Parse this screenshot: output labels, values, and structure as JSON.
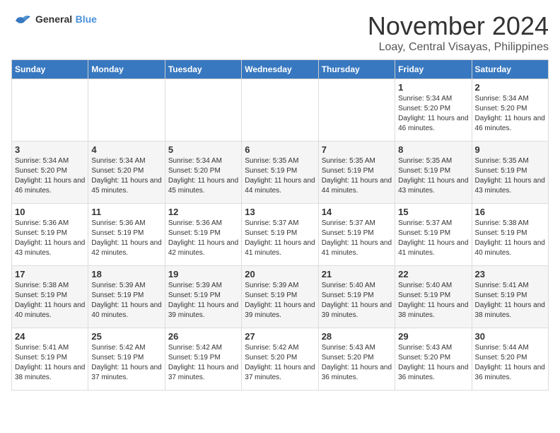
{
  "header": {
    "logo": {
      "general": "General",
      "blue": "Blue"
    },
    "month": "November 2024",
    "location": "Loay, Central Visayas, Philippines"
  },
  "weekdays": [
    "Sunday",
    "Monday",
    "Tuesday",
    "Wednesday",
    "Thursday",
    "Friday",
    "Saturday"
  ],
  "weeks": [
    [
      {
        "day": "",
        "info": ""
      },
      {
        "day": "",
        "info": ""
      },
      {
        "day": "",
        "info": ""
      },
      {
        "day": "",
        "info": ""
      },
      {
        "day": "",
        "info": ""
      },
      {
        "day": "1",
        "info": "Sunrise: 5:34 AM\nSunset: 5:20 PM\nDaylight: 11 hours and 46 minutes."
      },
      {
        "day": "2",
        "info": "Sunrise: 5:34 AM\nSunset: 5:20 PM\nDaylight: 11 hours and 46 minutes."
      }
    ],
    [
      {
        "day": "3",
        "info": "Sunrise: 5:34 AM\nSunset: 5:20 PM\nDaylight: 11 hours and 46 minutes."
      },
      {
        "day": "4",
        "info": "Sunrise: 5:34 AM\nSunset: 5:20 PM\nDaylight: 11 hours and 45 minutes."
      },
      {
        "day": "5",
        "info": "Sunrise: 5:34 AM\nSunset: 5:20 PM\nDaylight: 11 hours and 45 minutes."
      },
      {
        "day": "6",
        "info": "Sunrise: 5:35 AM\nSunset: 5:19 PM\nDaylight: 11 hours and 44 minutes."
      },
      {
        "day": "7",
        "info": "Sunrise: 5:35 AM\nSunset: 5:19 PM\nDaylight: 11 hours and 44 minutes."
      },
      {
        "day": "8",
        "info": "Sunrise: 5:35 AM\nSunset: 5:19 PM\nDaylight: 11 hours and 43 minutes."
      },
      {
        "day": "9",
        "info": "Sunrise: 5:35 AM\nSunset: 5:19 PM\nDaylight: 11 hours and 43 minutes."
      }
    ],
    [
      {
        "day": "10",
        "info": "Sunrise: 5:36 AM\nSunset: 5:19 PM\nDaylight: 11 hours and 43 minutes."
      },
      {
        "day": "11",
        "info": "Sunrise: 5:36 AM\nSunset: 5:19 PM\nDaylight: 11 hours and 42 minutes."
      },
      {
        "day": "12",
        "info": "Sunrise: 5:36 AM\nSunset: 5:19 PM\nDaylight: 11 hours and 42 minutes."
      },
      {
        "day": "13",
        "info": "Sunrise: 5:37 AM\nSunset: 5:19 PM\nDaylight: 11 hours and 41 minutes."
      },
      {
        "day": "14",
        "info": "Sunrise: 5:37 AM\nSunset: 5:19 PM\nDaylight: 11 hours and 41 minutes."
      },
      {
        "day": "15",
        "info": "Sunrise: 5:37 AM\nSunset: 5:19 PM\nDaylight: 11 hours and 41 minutes."
      },
      {
        "day": "16",
        "info": "Sunrise: 5:38 AM\nSunset: 5:19 PM\nDaylight: 11 hours and 40 minutes."
      }
    ],
    [
      {
        "day": "17",
        "info": "Sunrise: 5:38 AM\nSunset: 5:19 PM\nDaylight: 11 hours and 40 minutes."
      },
      {
        "day": "18",
        "info": "Sunrise: 5:39 AM\nSunset: 5:19 PM\nDaylight: 11 hours and 40 minutes."
      },
      {
        "day": "19",
        "info": "Sunrise: 5:39 AM\nSunset: 5:19 PM\nDaylight: 11 hours and 39 minutes."
      },
      {
        "day": "20",
        "info": "Sunrise: 5:39 AM\nSunset: 5:19 PM\nDaylight: 11 hours and 39 minutes."
      },
      {
        "day": "21",
        "info": "Sunrise: 5:40 AM\nSunset: 5:19 PM\nDaylight: 11 hours and 39 minutes."
      },
      {
        "day": "22",
        "info": "Sunrise: 5:40 AM\nSunset: 5:19 PM\nDaylight: 11 hours and 38 minutes."
      },
      {
        "day": "23",
        "info": "Sunrise: 5:41 AM\nSunset: 5:19 PM\nDaylight: 11 hours and 38 minutes."
      }
    ],
    [
      {
        "day": "24",
        "info": "Sunrise: 5:41 AM\nSunset: 5:19 PM\nDaylight: 11 hours and 38 minutes."
      },
      {
        "day": "25",
        "info": "Sunrise: 5:42 AM\nSunset: 5:19 PM\nDaylight: 11 hours and 37 minutes."
      },
      {
        "day": "26",
        "info": "Sunrise: 5:42 AM\nSunset: 5:19 PM\nDaylight: 11 hours and 37 minutes."
      },
      {
        "day": "27",
        "info": "Sunrise: 5:42 AM\nSunset: 5:20 PM\nDaylight: 11 hours and 37 minutes."
      },
      {
        "day": "28",
        "info": "Sunrise: 5:43 AM\nSunset: 5:20 PM\nDaylight: 11 hours and 36 minutes."
      },
      {
        "day": "29",
        "info": "Sunrise: 5:43 AM\nSunset: 5:20 PM\nDaylight: 11 hours and 36 minutes."
      },
      {
        "day": "30",
        "info": "Sunrise: 5:44 AM\nSunset: 5:20 PM\nDaylight: 11 hours and 36 minutes."
      }
    ]
  ]
}
